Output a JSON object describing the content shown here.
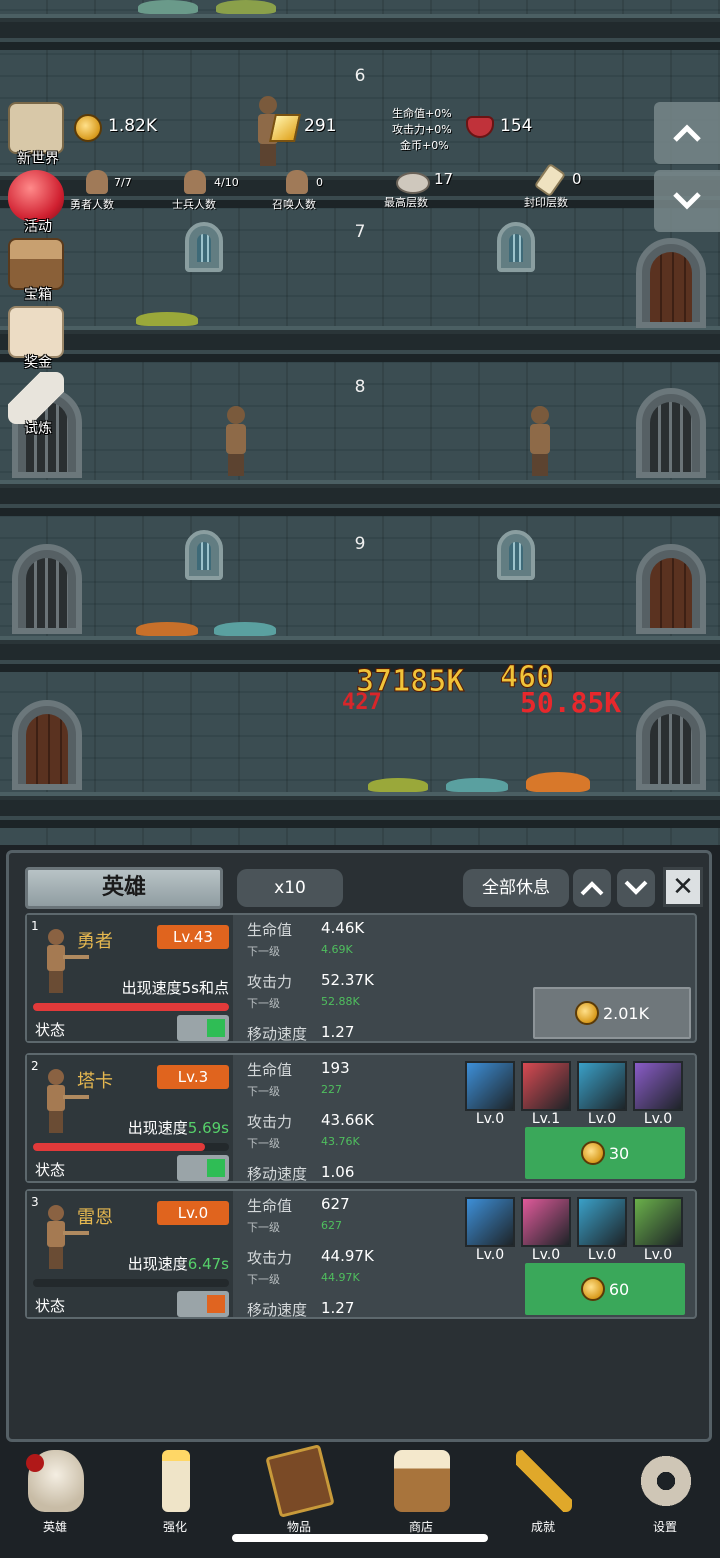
{
  "scene": {
    "floors": [
      "6",
      "7",
      "8",
      "9"
    ],
    "top_stats": {
      "gold": "1.82K",
      "gold_bars": "291",
      "buffs": [
        "生命值+0%",
        "攻击力+0%",
        "金币+0%"
      ],
      "gems": "154"
    },
    "counts": [
      {
        "value": "7/7",
        "label": "勇者人数"
      },
      {
        "value": "4/10",
        "label": "士兵人数"
      },
      {
        "value": "0",
        "label": "召唤人数"
      },
      {
        "value": "17",
        "label": "最高层数"
      },
      {
        "value": "0",
        "label": "封印层数"
      }
    ],
    "damage_numbers": [
      "37185K",
      "460",
      "427",
      "50.85K"
    ]
  },
  "left_menu": [
    {
      "label": "新世界",
      "icon": "map-icon"
    },
    {
      "label": "活动",
      "icon": "heart-icon"
    },
    {
      "label": "宝箱",
      "icon": "chest-icon"
    },
    {
      "label": "奖金",
      "icon": "envelope-icon"
    },
    {
      "label": "试炼",
      "icon": "feather-icon"
    }
  ],
  "panel": {
    "tab_title": "英雄",
    "multiplier": "x10",
    "rest_all": "全部休息",
    "heroes": [
      {
        "index": "1",
        "name": "勇者",
        "level": "Lv.43",
        "spawn_prefix": "出现速度5s和点",
        "spawn_value": "",
        "hp_fraction": 1.0,
        "state_label": "状态",
        "state_color": "#2fbd55",
        "hp_label": "生命值",
        "hp": "4.46K",
        "next_label": "下一级",
        "hp_next": "4.69K",
        "atk_label": "攻击力",
        "atk": "52.37K",
        "atk_next": "52.88K",
        "spd_label": "移动速度",
        "spd": "1.27",
        "cost": "2.01K",
        "cost_btn_color": "#6f777b",
        "equipment": []
      },
      {
        "index": "2",
        "name": "塔卡",
        "level": "Lv.3",
        "spawn_prefix": "出现速度",
        "spawn_value": "5.69s",
        "hp_fraction": 0.88,
        "state_label": "状态",
        "state_color": "#2fbd55",
        "hp_label": "生命值",
        "hp": "193",
        "next_label": "下一级",
        "hp_next": "227",
        "atk_label": "攻击力",
        "atk": "43.66K",
        "atk_next": "43.76K",
        "spd_label": "移动速度",
        "spd": "1.06",
        "cost": "30",
        "cost_btn_color": "#3aa85a",
        "equipment": [
          {
            "name": "axe-icon",
            "level": "Lv.0",
            "bg": "#3d8fd8"
          },
          {
            "name": "battleaxe-icon",
            "level": "Lv.1",
            "bg": "#d84a52"
          },
          {
            "name": "boots-icon",
            "level": "Lv.0",
            "bg": "#3aa0c8"
          },
          {
            "name": "gauntlet-icon",
            "level": "Lv.0",
            "bg": "#8a5cc8"
          }
        ]
      },
      {
        "index": "3",
        "name": "雷恩",
        "level": "Lv.0",
        "spawn_prefix": "出现速度",
        "spawn_value": "6.47s",
        "hp_fraction": 0,
        "state_label": "状态",
        "state_color": "#e06420",
        "hp_label": "生命值",
        "hp": "627",
        "next_label": "下一级",
        "hp_next": "627",
        "atk_label": "攻击力",
        "atk": "44.97K",
        "atk_next": "44.97K",
        "spd_label": "移动速度",
        "spd": "1.27",
        "cost": "60",
        "cost_btn_color": "#3aa85a",
        "equipment": [
          {
            "name": "sword-icon",
            "level": "Lv.0",
            "bg": "#3d8fd8"
          },
          {
            "name": "dagger-icon",
            "level": "Lv.0",
            "bg": "#e05a9a"
          },
          {
            "name": "boots-icon",
            "level": "Lv.0",
            "bg": "#3aa0c8"
          },
          {
            "name": "leaf-icon",
            "level": "Lv.0",
            "bg": "#6ab04a"
          }
        ]
      }
    ]
  },
  "nav": [
    {
      "label": "英雄",
      "icon": "skull-icon"
    },
    {
      "label": "强化",
      "icon": "candle-icon"
    },
    {
      "label": "物品",
      "icon": "book-icon"
    },
    {
      "label": "商店",
      "icon": "mug-icon"
    },
    {
      "label": "成就",
      "icon": "key-icon"
    },
    {
      "label": "设置",
      "icon": "gear-icon"
    }
  ]
}
